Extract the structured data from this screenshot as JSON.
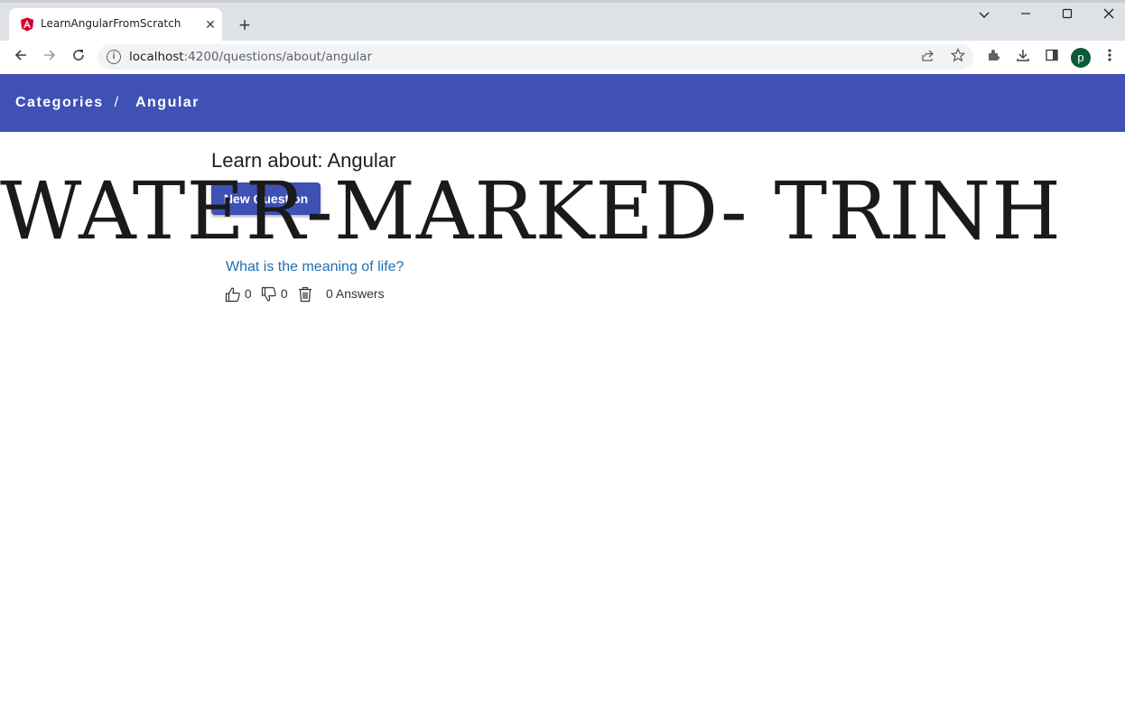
{
  "browser": {
    "tab_title": "LearnAngularFromScratch",
    "url_host": "localhost",
    "url_rest": ":4200/questions/about/angular",
    "profile_initial": "p"
  },
  "header": {
    "breadcrumb_root": "Categories",
    "breadcrumb_separator": "/",
    "breadcrumb_current": "Angular"
  },
  "main": {
    "title": "Learn about: Angular",
    "new_question_label": "New Question",
    "watermark": "WATER-MARKED- TRINH"
  },
  "questions": [
    {
      "title": "What is the meaning of life?",
      "upvotes": "0",
      "downvotes": "0",
      "answers_label": "0 Answers"
    }
  ],
  "colors": {
    "appbar": "#3f51b5",
    "link": "#1f6fb2"
  }
}
